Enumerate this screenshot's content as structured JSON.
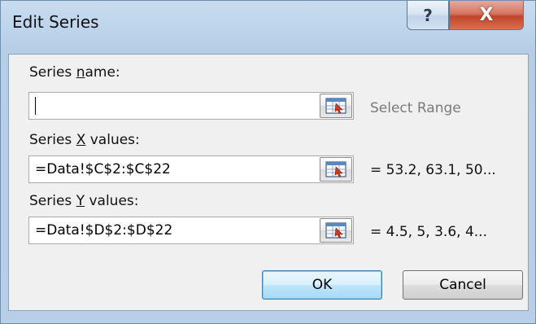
{
  "dialog": {
    "title": "Edit Series",
    "help_label": "?",
    "close_label": "X"
  },
  "series_name": {
    "label_pre": "Series ",
    "label_ul": "n",
    "label_post": "ame:",
    "value": "",
    "preview": "Select Range"
  },
  "series_x": {
    "label_pre": "Series ",
    "label_ul": "X",
    "label_post": " values:",
    "value": "=Data!$C$2:$C$22",
    "preview": "= 53.2, 63.1, 50..."
  },
  "series_y": {
    "label_pre": "Series ",
    "label_ul": "Y",
    "label_post": " values:",
    "value": "=Data!$D$2:$D$22",
    "preview": "= 4.5, 5, 3.6, 4..."
  },
  "buttons": {
    "ok": "OK",
    "cancel": "Cancel"
  },
  "icons": {
    "range_selector": "collapse-dialog-icon"
  }
}
